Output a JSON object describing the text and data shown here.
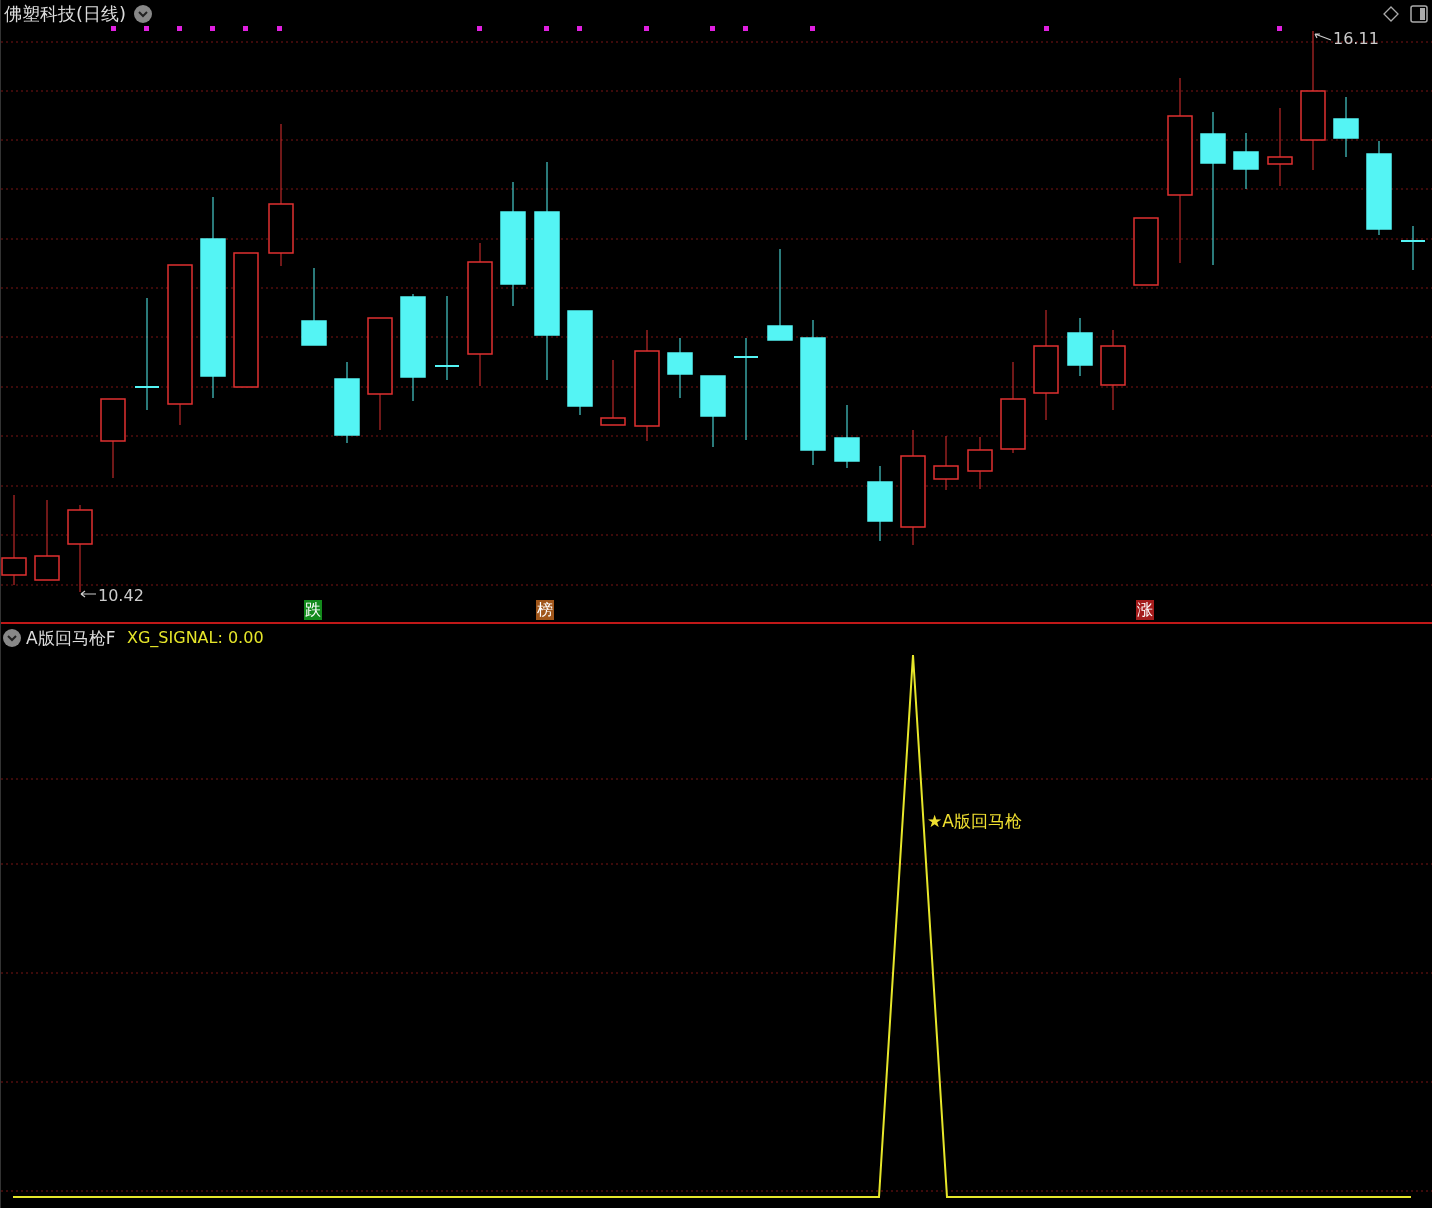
{
  "title": "佛塑科技(日线)",
  "price_chart": {
    "high_label": "16.11",
    "low_label": "10.42",
    "markers": [
      {
        "text": "跌",
        "color": "#138a1c"
      },
      {
        "text": "榜",
        "color": "#a0561a"
      },
      {
        "text": "涨",
        "color": "#a51c1c"
      }
    ]
  },
  "indicator": {
    "name": "A版回马枪F",
    "value_label": "XG_SIGNAL: 0.00",
    "signal_label": "★A版回马枪"
  }
}
